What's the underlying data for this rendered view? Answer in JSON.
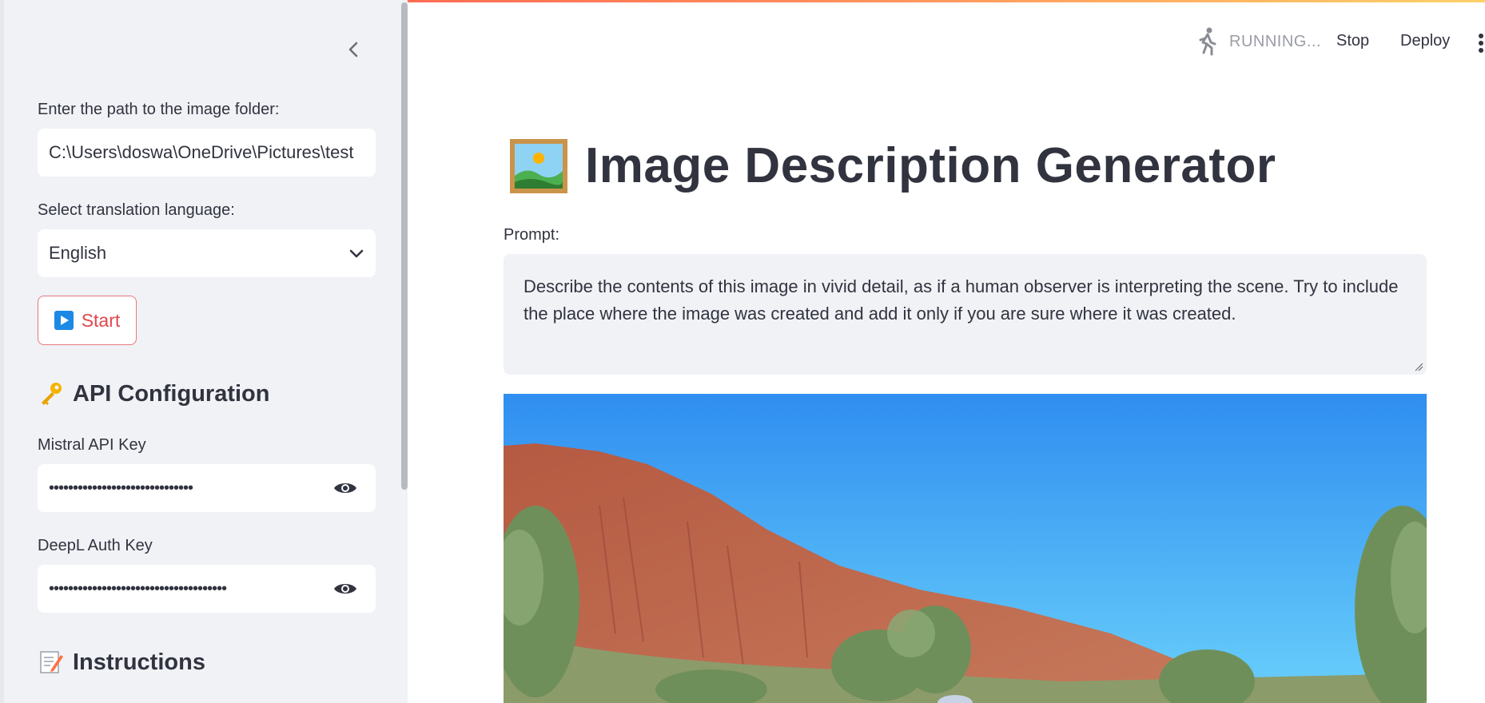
{
  "sidebar": {
    "folder_label": "Enter the path to the image folder:",
    "folder_value": "C:\\Users\\doswa\\OneDrive\\Pictures\\test",
    "language_label": "Select translation language:",
    "language_value": "English",
    "start_label": "Start",
    "api_heading": "API Configuration",
    "mistral_label": "Mistral API Key",
    "mistral_value": "••••••••••••••••••••••••••••••",
    "deepl_label": "DeepL Auth Key",
    "deepl_value": "•••••••••••••••••••••••••••••••••••••",
    "instructions_heading": "Instructions"
  },
  "header": {
    "status": "RUNNING...",
    "stop_label": "Stop",
    "deploy_label": "Deploy"
  },
  "main": {
    "title": "Image Description Generator",
    "prompt_label": "Prompt:",
    "prompt_text": "Describe the contents of this image in vivid detail, as if a human observer is interpreting the scene. Try to include the place where the image was created and add it only if you are sure where it was created."
  },
  "colors": {
    "accent": "#ff4b4b",
    "sidebar_bg": "#f0f2f6",
    "text": "#31333f"
  },
  "icons": [
    "chevron-left-icon",
    "chevron-down-icon",
    "play-icon",
    "key-icon",
    "eye-icon",
    "memo-icon",
    "running-man-icon",
    "kebab-menu-icon",
    "framed-picture-icon"
  ]
}
